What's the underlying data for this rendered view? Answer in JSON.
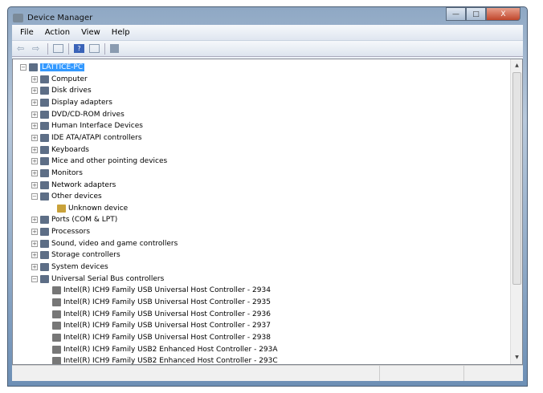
{
  "window": {
    "title": "Device Manager",
    "controls": {
      "minimize": "—",
      "maximize": "□",
      "close": "X"
    }
  },
  "menu": [
    "File",
    "Action",
    "View",
    "Help"
  ],
  "toolbar": [
    "back-icon",
    "forward-icon",
    "properties-icon",
    "help-icon",
    "view-icon",
    "scan-icon"
  ],
  "tree": {
    "root": "LATTICE-PC",
    "categories": [
      {
        "label": "Computer",
        "expanded": false
      },
      {
        "label": "Disk drives",
        "expanded": false
      },
      {
        "label": "Display adapters",
        "expanded": false
      },
      {
        "label": "DVD/CD-ROM drives",
        "expanded": false
      },
      {
        "label": "Human Interface Devices",
        "expanded": false
      },
      {
        "label": "IDE ATA/ATAPI controllers",
        "expanded": false
      },
      {
        "label": "Keyboards",
        "expanded": false
      },
      {
        "label": "Mice and other pointing devices",
        "expanded": false
      },
      {
        "label": "Monitors",
        "expanded": false
      },
      {
        "label": "Network adapters",
        "expanded": false
      },
      {
        "label": "Other devices",
        "expanded": true,
        "children": [
          "Unknown device"
        ]
      },
      {
        "label": "Ports (COM & LPT)",
        "expanded": false
      },
      {
        "label": "Processors",
        "expanded": false
      },
      {
        "label": "Sound, video and game controllers",
        "expanded": false
      },
      {
        "label": "Storage controllers",
        "expanded": false
      },
      {
        "label": "System devices",
        "expanded": false
      },
      {
        "label": "Universal Serial Bus controllers",
        "expanded": true,
        "children": [
          "Intel(R) ICH9 Family USB Universal Host Controller - 2934",
          "Intel(R) ICH9 Family USB Universal Host Controller - 2935",
          "Intel(R) ICH9 Family USB Universal Host Controller - 2936",
          "Intel(R) ICH9 Family USB Universal Host Controller - 2937",
          "Intel(R) ICH9 Family USB Universal Host Controller - 2938",
          "Intel(R) ICH9 Family USB2 Enhanced Host Controller - 293A",
          "Intel(R) ICH9 Family USB2 Enhanced Host Controller - 293C"
        ]
      }
    ]
  }
}
